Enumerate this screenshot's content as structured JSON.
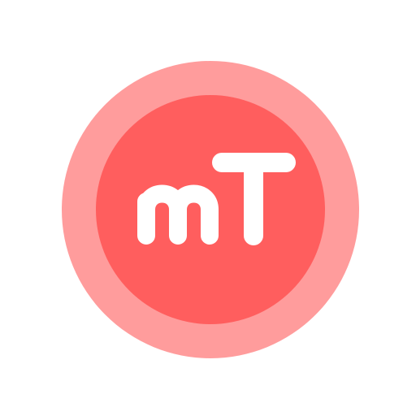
{
  "logo": {
    "monogram": "mT",
    "colors": {
      "outer_ring": "#FF9C9C",
      "inner_disc": "#FF5E5E",
      "glyph": "#FFFFFF",
      "background": "#FFFFFF"
    }
  }
}
